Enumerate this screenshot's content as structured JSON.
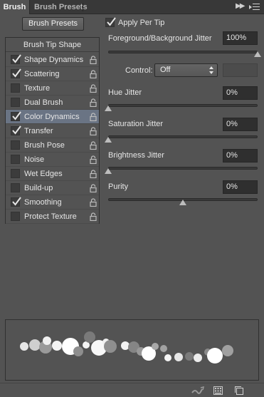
{
  "tabs": {
    "active": "Brush",
    "inactive": "Brush Presets",
    "collapse_icon": "double-chevron-right-icon",
    "menu_icon": "panel-menu-icon"
  },
  "left": {
    "presets_button": "Brush Presets",
    "list_header": "Brush Tip Shape",
    "items": [
      {
        "label": "Shape Dynamics",
        "checked": true,
        "selected": false
      },
      {
        "label": "Scattering",
        "checked": true,
        "selected": false
      },
      {
        "label": "Texture",
        "checked": false,
        "selected": false
      },
      {
        "label": "Dual Brush",
        "checked": false,
        "selected": false
      },
      {
        "label": "Color Dynamics",
        "checked": true,
        "selected": true
      },
      {
        "label": "Transfer",
        "checked": true,
        "selected": false
      },
      {
        "label": "Brush Pose",
        "checked": false,
        "selected": false
      },
      {
        "label": "Noise",
        "checked": false,
        "selected": false
      },
      {
        "label": "Wet Edges",
        "checked": false,
        "selected": false
      },
      {
        "label": "Build-up",
        "checked": false,
        "selected": false
      },
      {
        "label": "Smoothing",
        "checked": true,
        "selected": false
      },
      {
        "label": "Protect Texture",
        "checked": false,
        "selected": false
      }
    ]
  },
  "right": {
    "apply_per_tip": {
      "label": "Apply Per Tip",
      "checked": true
    },
    "fg_bg_jitter": {
      "label": "Foreground/Background Jitter",
      "value": "100%",
      "level": 1.0
    },
    "control": {
      "label": "Control:",
      "value": "Off"
    },
    "hue_jitter": {
      "label": "Hue Jitter",
      "value": "0%",
      "level": 0.0
    },
    "saturation_jitter": {
      "label": "Saturation Jitter",
      "value": "0%",
      "level": 0.0
    },
    "brightness_jitter": {
      "label": "Brightness Jitter",
      "value": "0%",
      "level": 0.0
    },
    "purity": {
      "label": "Purity",
      "value": "0%",
      "level": 0.5
    }
  },
  "bottom": {
    "icons": [
      "toggle-live-tip-preview-icon",
      "show-selected-brush-preset-icon",
      "create-new-brush-icon"
    ]
  },
  "colors": {
    "panel_bg": "#535353",
    "tabbar_bg": "#383838",
    "selected_row": "#6a7484",
    "input_bg": "#2f2f2f"
  }
}
